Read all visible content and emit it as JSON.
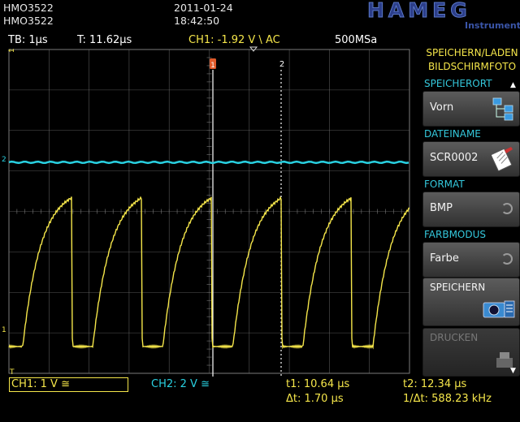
{
  "header": {
    "model_1": "HMO3522",
    "model_2": "HMO3522",
    "date": "2011-01-24",
    "time": "18:42:50",
    "brand": "HAMEG",
    "brand_sub": "Instruments"
  },
  "status": {
    "timebase": "TB: 1µs",
    "trigger_time": "T: 11.62µs",
    "trigger_info": "CH1: -1.92 V \\ AC",
    "sample_rate": "500MSa"
  },
  "menu": {
    "title_line1": "SPEICHERN/LADEN",
    "title_line2": "BILDSCHIRMFOTO",
    "items": [
      {
        "label": "SPEICHERORT",
        "value": "Vorn",
        "icon": "folder-tree-icon"
      },
      {
        "label": "DATEINAME",
        "value": "SCR0002",
        "icon": "edit-file-icon"
      },
      {
        "label": "FORMAT",
        "value": "BMP",
        "icon": "rotary-knob-icon"
      },
      {
        "label": "FARBMODUS",
        "value": "Farbe",
        "icon": "rotary-knob-icon"
      }
    ],
    "save_label": "SPEICHERN",
    "print_label": "DRUCKEN"
  },
  "footer": {
    "ch1": "CH1: 1 V ≅",
    "ch2": "CH2: 2 V ≅",
    "t1": "t1: 10.64 µs",
    "delta_t": "Δt: 1.70 µs",
    "t2": "t2: 12.34 µs",
    "inv_delta_t": "1/Δt: 588.23 kHz"
  },
  "markers": {
    "cursor1": "1",
    "cursor2": "2",
    "ch1_marker": "1",
    "ch2_marker": "2",
    "trigger_marker": "T"
  },
  "colors": {
    "ch1": "#f5e64a",
    "ch2": "#29d0e0",
    "grid": "#7a7a7a",
    "cursor1": "#e05a2a",
    "brand": "#2c3e8a"
  }
}
